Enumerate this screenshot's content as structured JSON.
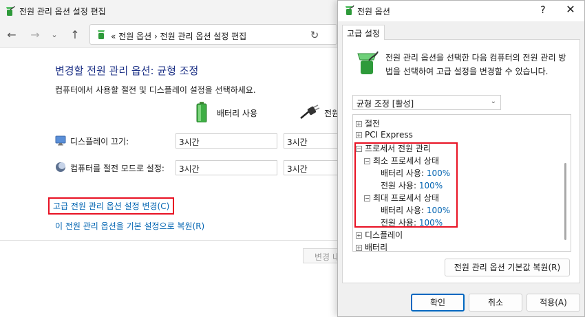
{
  "background": {
    "title": "전원 관리 옵션 설정 편집",
    "address": "« 전원 옵션 › 전원 관리 옵션 설정 편집",
    "heading": "변경할 전원 관리 옵션: 균형 조정",
    "description": "컴퓨터에서 사용할 절전 및 디스플레이 설정을 선택하세요.",
    "col_battery": "배터리 사용",
    "col_plugged": "전원",
    "rows": [
      {
        "label": "디스플레이 끄기:",
        "battery": "3시간",
        "plugged": "3시간"
      },
      {
        "label": "컴퓨터를 절전 모드로 설정:",
        "battery": "3시간",
        "plugged": "3시간"
      }
    ],
    "advanced_link": "고급 전원 관리 옵션 설정 변경(C)",
    "restore_link": "이 전원 관리 옵션을 기본 설정으로 복원(R)",
    "save_button": "변경 내용 저장"
  },
  "dialog": {
    "title": "전원 옵션",
    "help": "?",
    "close": "✕",
    "tab": "고급 설정",
    "description": "전원 관리 옵션을 선택한 다음 컴퓨터의 전원 관리 방법을 선택하여 고급 설정을 변경할 수 있습니다.",
    "plan": "균형 조정 [활성]",
    "tree": {
      "sleep": "절전",
      "pci": "PCI Express",
      "processor": "프로세서 전원 관리",
      "min_state": "최소 프로세서 상태",
      "min_battery_label": "배터리 사용:",
      "min_battery_value": "100%",
      "min_plugged_label": "전원 사용:",
      "min_plugged_value": "100%",
      "max_state": "최대 프로세서 상태",
      "max_battery_label": "배터리 사용:",
      "max_battery_value": "100%",
      "max_plugged_label": "전원 사용:",
      "max_plugged_value": "100%",
      "display": "디스플레이",
      "battery": "배터리"
    },
    "restore_button": "전원 관리 옵션 기본값 복원(R)",
    "ok_button": "확인",
    "cancel_button": "취소",
    "apply_button": "적용(A)"
  }
}
